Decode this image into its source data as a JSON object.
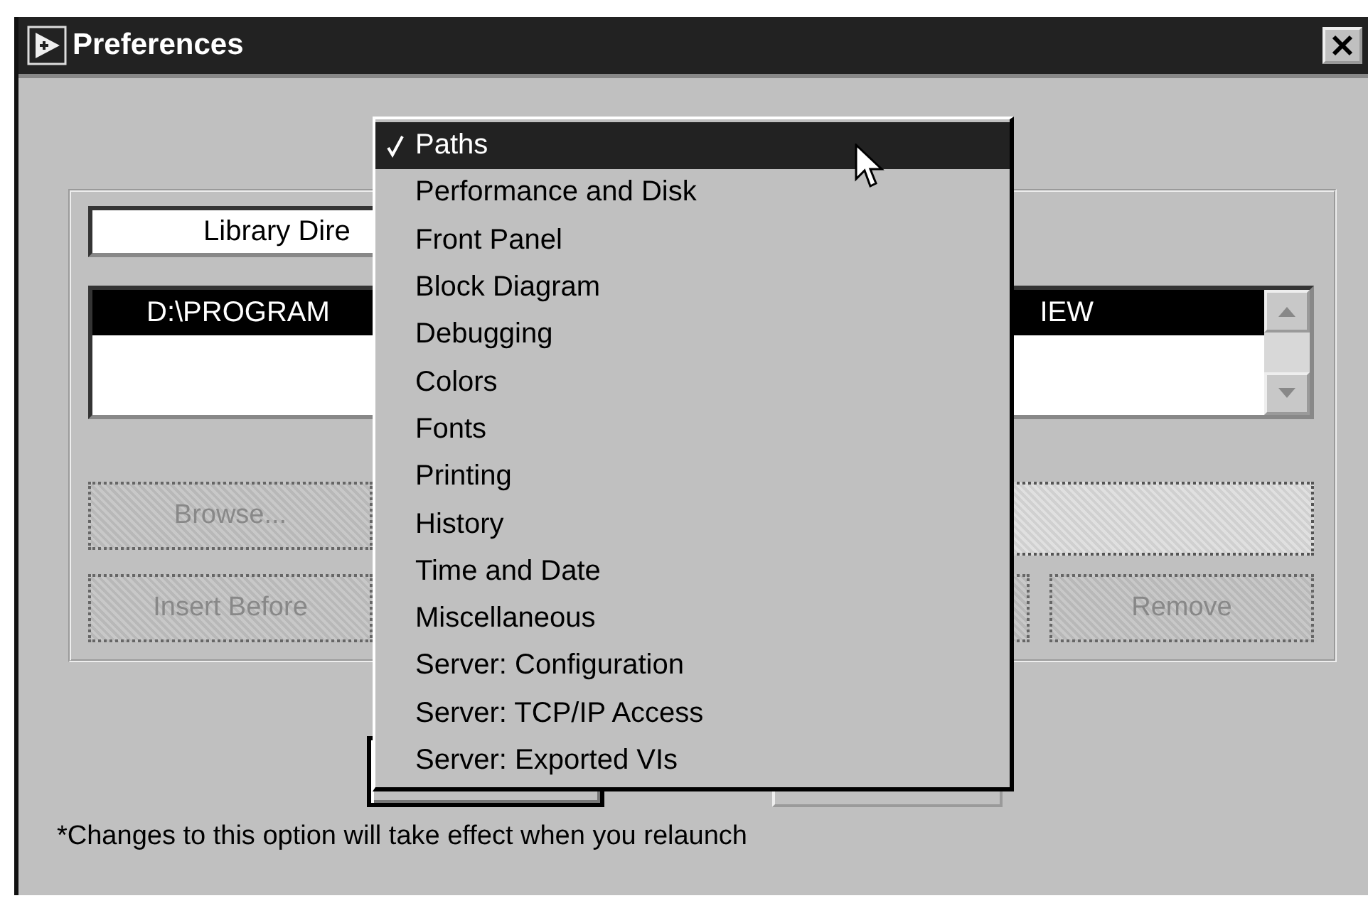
{
  "window": {
    "title": "Preferences"
  },
  "category_field": {
    "value": "Library Dire"
  },
  "directory_list": {
    "rows": [
      {
        "start": "D:\\PROGRAM",
        "end": "IEW",
        "selected": true
      }
    ]
  },
  "browse_row": {
    "button": {
      "label": "Browse...",
      "disabled": true
    },
    "path_field": {
      "disabled": true
    }
  },
  "action_buttons": [
    {
      "label": "Insert Before",
      "disabled": true
    },
    {
      "disabled": true
    },
    {
      "label": "Remove",
      "disabled": true
    }
  ],
  "dialog_buttons": [
    {
      "kind": "default"
    },
    {
      "kind": "normal"
    }
  ],
  "footnote": "*Changes to this option will take effect when you relaunch",
  "menu": {
    "items": [
      {
        "label": "Paths",
        "checked": true,
        "selected": true
      },
      {
        "label": "Performance and Disk",
        "checked": false,
        "selected": false
      },
      {
        "label": "Front Panel",
        "checked": false,
        "selected": false
      },
      {
        "label": "Block Diagram",
        "checked": false,
        "selected": false
      },
      {
        "label": "Debugging",
        "checked": false,
        "selected": false
      },
      {
        "label": "Colors",
        "checked": false,
        "selected": false
      },
      {
        "label": "Fonts",
        "checked": false,
        "selected": false
      },
      {
        "label": "Printing",
        "checked": false,
        "selected": false
      },
      {
        "label": "History",
        "checked": false,
        "selected": false
      },
      {
        "label": "Time and Date",
        "checked": false,
        "selected": false
      },
      {
        "label": "Miscellaneous",
        "checked": false,
        "selected": false
      },
      {
        "label": "Server: Configuration",
        "checked": false,
        "selected": false
      },
      {
        "label": "Server: TCP/IP Access",
        "checked": false,
        "selected": false
      },
      {
        "label": "Server: Exported VIs",
        "checked": false,
        "selected": false
      }
    ]
  }
}
